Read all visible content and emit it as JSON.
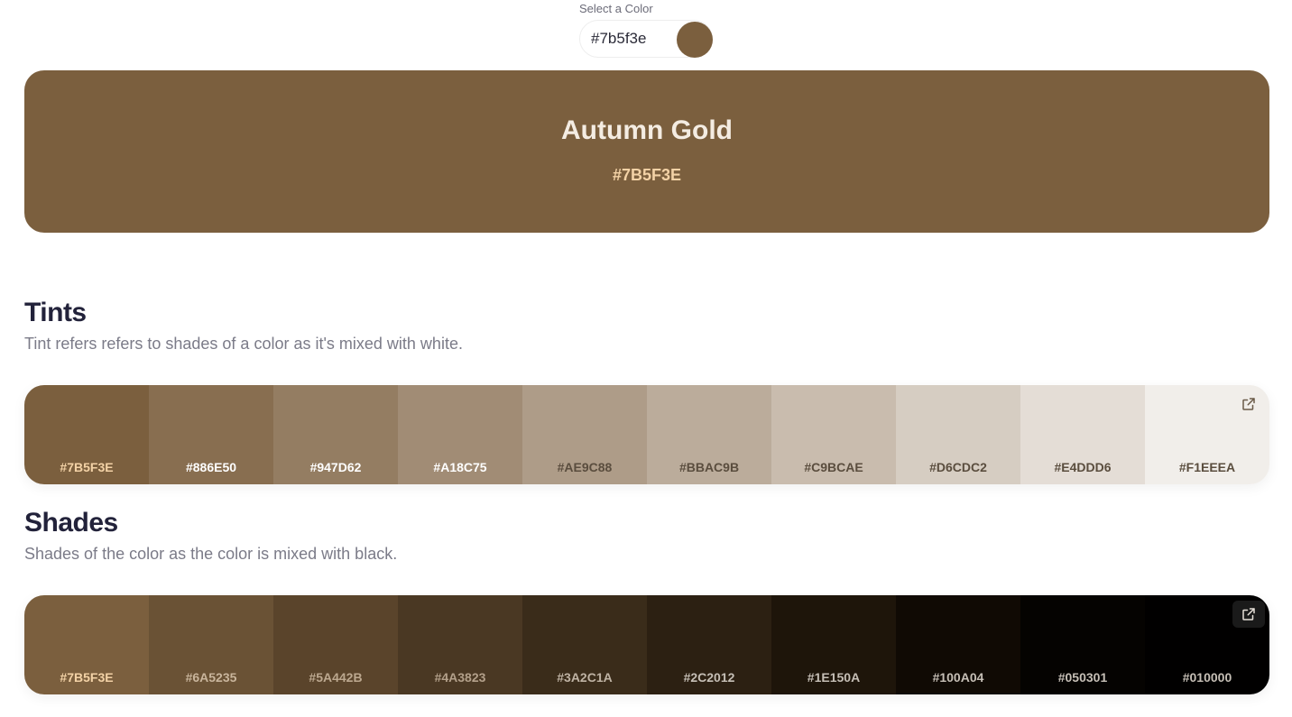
{
  "picker": {
    "label": "Select a Color",
    "value": "#7b5f3e",
    "swatch_color": "#7B5F3E"
  },
  "hero": {
    "name": "Autumn Gold",
    "hex": "#7B5F3E",
    "background": "#7B5F3E",
    "hex_text_color": "#F3D2A6"
  },
  "tints": {
    "title": "Tints",
    "description": "Tint refers refers to shades of a color as it's mixed with white.",
    "open_icon": "external-link-icon",
    "swatches": [
      {
        "hex": "#7B5F3E",
        "text_color": "#F3D2A6"
      },
      {
        "hex": "#886E50",
        "text_color": "#FFFFFF"
      },
      {
        "hex": "#947D62",
        "text_color": "#FFFFFF"
      },
      {
        "hex": "#A18C75",
        "text_color": "#FFFFFF"
      },
      {
        "hex": "#AE9C88",
        "text_color": "#5A4D3E"
      },
      {
        "hex": "#BBAC9B",
        "text_color": "#5A4D3E"
      },
      {
        "hex": "#C9BCAE",
        "text_color": "#5A4D3E"
      },
      {
        "hex": "#D6CDC2",
        "text_color": "#5A4D3E"
      },
      {
        "hex": "#E4DDD6",
        "text_color": "#5A4D3E"
      },
      {
        "hex": "#F1EEEA",
        "text_color": "#5A4D3E"
      }
    ]
  },
  "shades": {
    "title": "Shades",
    "description": "Shades of the color as the color is mixed with black.",
    "open_icon": "external-link-icon",
    "swatches": [
      {
        "hex": "#7B5F3E",
        "text_color": "#F3D2A6"
      },
      {
        "hex": "#6A5235",
        "text_color": "#C9B59C"
      },
      {
        "hex": "#5A442B",
        "text_color": "#BCA88F"
      },
      {
        "hex": "#4A3823",
        "text_color": "#B3A08A"
      },
      {
        "hex": "#3A2C1A",
        "text_color": "#BFB3A4"
      },
      {
        "hex": "#2C2012",
        "text_color": "#C6BFB6"
      },
      {
        "hex": "#1E150A",
        "text_color": "#C6BFB6"
      },
      {
        "hex": "#100A04",
        "text_color": "#C6BFB6"
      },
      {
        "hex": "#050301",
        "text_color": "#C6BFB6"
      },
      {
        "hex": "#010000",
        "text_color": "#C6BFB6"
      }
    ]
  }
}
